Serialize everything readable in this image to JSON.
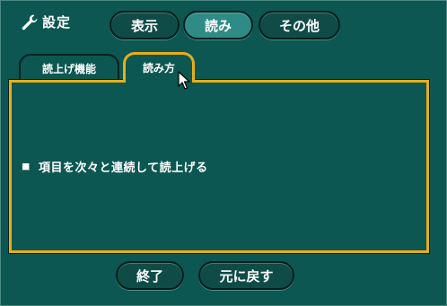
{
  "header": {
    "title": "設定",
    "icon": "wrench-icon"
  },
  "top_tabs": [
    {
      "label": "表示",
      "active": false
    },
    {
      "label": "読み",
      "active": true
    },
    {
      "label": "その他",
      "active": false
    }
  ],
  "sub_tabs": [
    {
      "label": "読上げ機能",
      "active": false
    },
    {
      "label": "読み方",
      "active": true
    }
  ],
  "panel": {
    "options": [
      {
        "label": "項目を次々と連続して読上げる",
        "checked": false
      }
    ]
  },
  "footer": {
    "end_label": "終了",
    "revert_label": "元に戻す"
  },
  "colors": {
    "background": "#0c5751",
    "active_accent": "#e8ad1a",
    "active_button": "#2e8b85",
    "text": "#ffffff"
  }
}
